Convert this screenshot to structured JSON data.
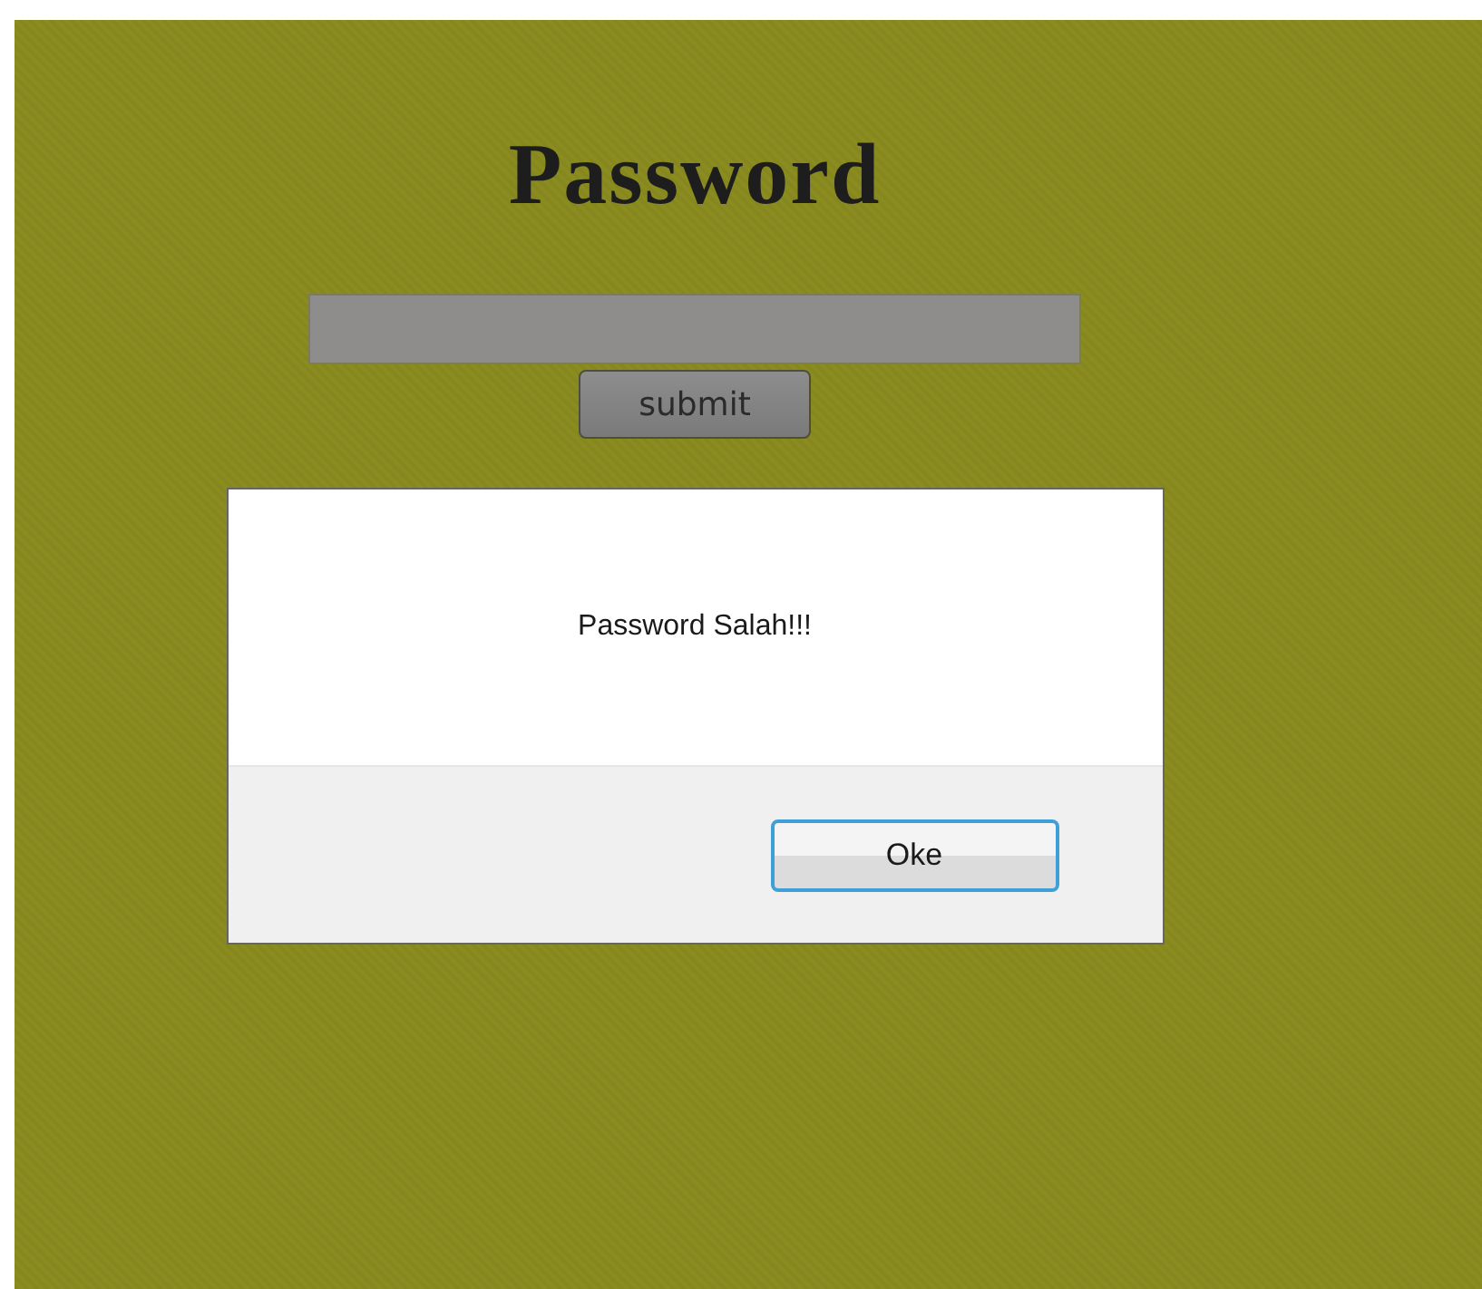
{
  "page": {
    "title": "Password"
  },
  "form": {
    "submit_button": "submit"
  },
  "dialog": {
    "message": "Password Salah!!!",
    "button": "Oke"
  }
}
